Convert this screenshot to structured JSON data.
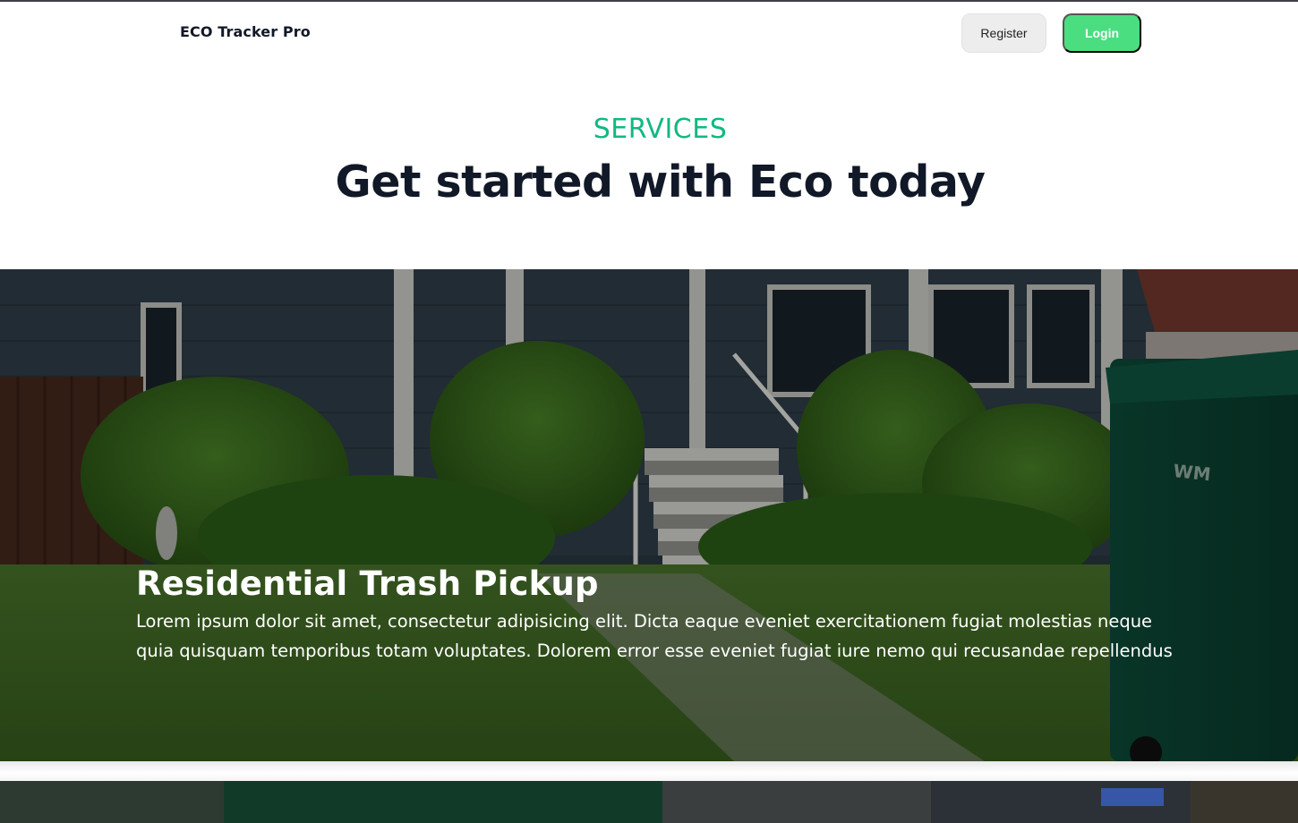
{
  "header": {
    "brand": "ECO Tracker Pro",
    "register_label": "Register",
    "login_label": "Login"
  },
  "services": {
    "eyebrow": "SERVICES",
    "title": "Get started with Eco today"
  },
  "cards": [
    {
      "title": "Residential Trash Pickup",
      "description": "Lorem ipsum dolor sit amet, consectetur adipisicing elit. Dicta eaque eveniet exercitationem fugiat molestias neque quia quisquam temporibus totam voluptates. Dolorem error esse eveniet fugiat iure nemo qui recusandae repellendus",
      "bin_logo": "WM"
    }
  ],
  "colors": {
    "accent": "#10b981",
    "login_bg": "#4ade80",
    "register_bg": "#ededed",
    "heading": "#111827"
  }
}
